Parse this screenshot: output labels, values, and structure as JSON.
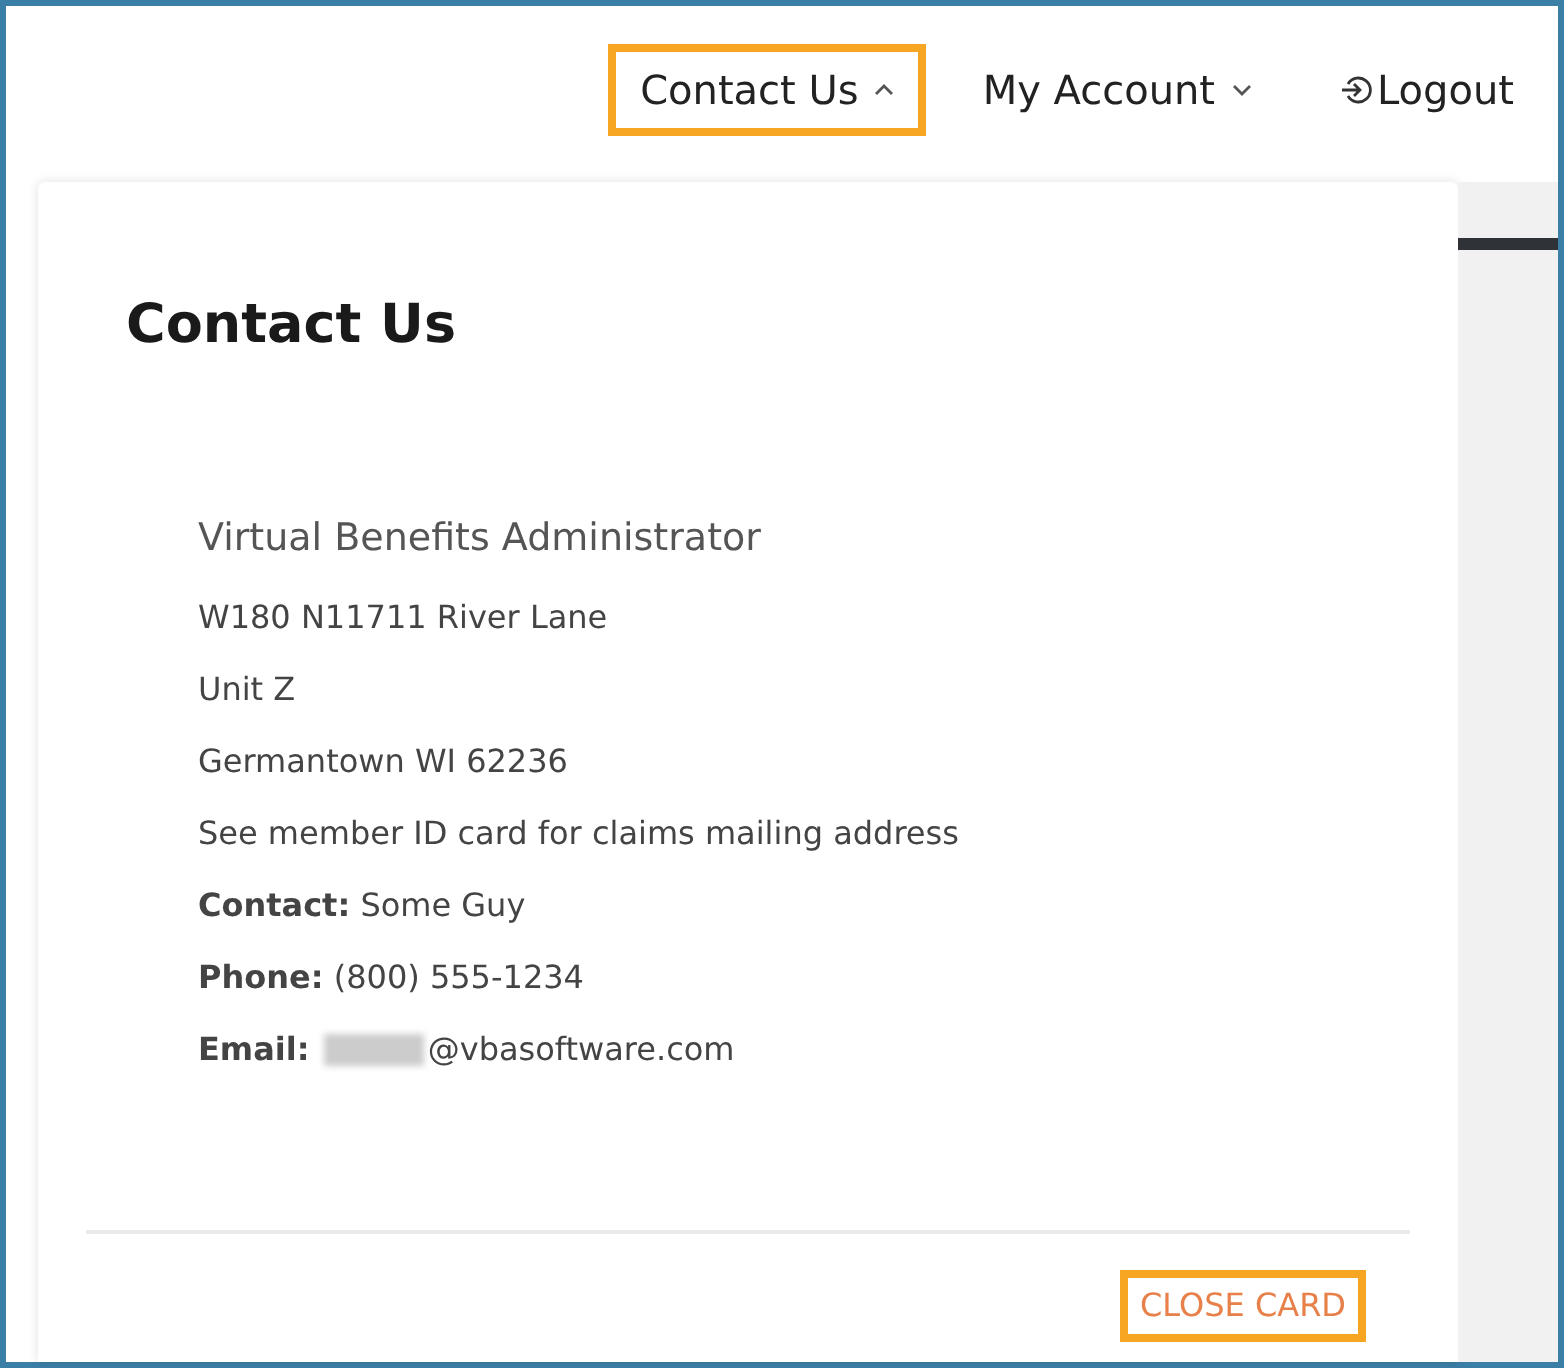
{
  "nav": [
    {
      "kind": "dropdown",
      "label": "Contact Us",
      "expanded": true,
      "highlighted": true
    },
    {
      "kind": "dropdown",
      "label": "My Account",
      "expanded": false,
      "highlighted": false
    },
    {
      "kind": "logout",
      "label": "Logout",
      "highlighted": false
    }
  ],
  "card": {
    "title": "Contact Us",
    "lines": [
      {
        "kind": "name",
        "text": "Virtual Benefits Administrator"
      },
      {
        "kind": "line",
        "text": "W180 N11711 River Lane"
      },
      {
        "kind": "line",
        "text": "Unit Z"
      },
      {
        "kind": "line",
        "text": "Germantown WI 62236"
      },
      {
        "kind": "line",
        "text": "See member ID card for claims mailing address"
      },
      {
        "kind": "line",
        "text": "**Contact:** Some Guy"
      },
      {
        "kind": "line",
        "text": "**Phone:** (800) 555-1234"
      },
      {
        "kind": "email",
        "label": "Email:",
        "redacted": true,
        "text": "@vbasoftware.com"
      }
    ],
    "close_button": {
      "label": "CLOSE CARD",
      "highlighted": true
    }
  }
}
